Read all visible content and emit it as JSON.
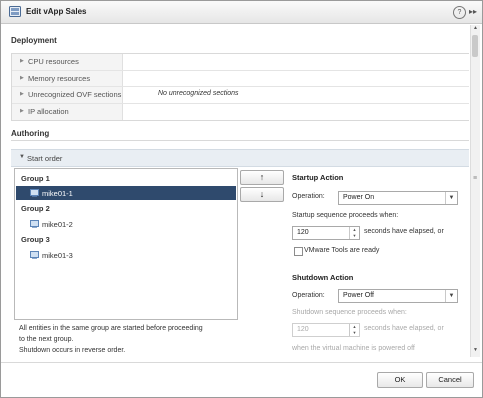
{
  "window": {
    "title": "Edit vApp Sales",
    "help_icon": "?",
    "expand_icon": "▸▸"
  },
  "deployment": {
    "heading": "Deployment",
    "rows": [
      {
        "label": "CPU resources",
        "value": ""
      },
      {
        "label": "Memory resources",
        "value": ""
      },
      {
        "label": "Unrecognized OVF sections",
        "value": "No unrecognized sections"
      },
      {
        "label": "IP allocation",
        "value": ""
      }
    ]
  },
  "authoring": {
    "heading": "Authoring",
    "start_order_label": "Start order"
  },
  "groups": [
    {
      "label": "Group 1",
      "vm": "mike01-1",
      "selected": true
    },
    {
      "label": "Group 2",
      "vm": "mike01-2",
      "selected": false
    },
    {
      "label": "Group 3",
      "vm": "mike01-3",
      "selected": false
    }
  ],
  "order_buttons": {
    "up": "↑",
    "down": "↓"
  },
  "notes": {
    "line1": "All entities in the same group are started before proceeding",
    "line2": "to the next group.",
    "line3": "Shutdown occurs in reverse order."
  },
  "startup": {
    "title": "Startup Action",
    "operation_label": "Operation:",
    "operation_value": "Power On",
    "sequence_label": "Startup sequence proceeds when:",
    "seconds_value": "120",
    "seconds_label": "seconds have elapsed, or",
    "vmware_tools_label": "VMware Tools are ready"
  },
  "shutdown": {
    "title": "Shutdown Action",
    "operation_label": "Operation:",
    "operation_value": "Power Off",
    "sequence_label": "Shutdown sequence proceeds when:",
    "seconds_value": "120",
    "seconds_label": "seconds have elapsed, or",
    "powered_off_label": "when the virtual machine is powered off"
  },
  "footer": {
    "ok_label": "OK",
    "cancel_label": "Cancel"
  },
  "colors": {
    "selection": "#2f4a6d",
    "header_band": "#e9eef3"
  }
}
